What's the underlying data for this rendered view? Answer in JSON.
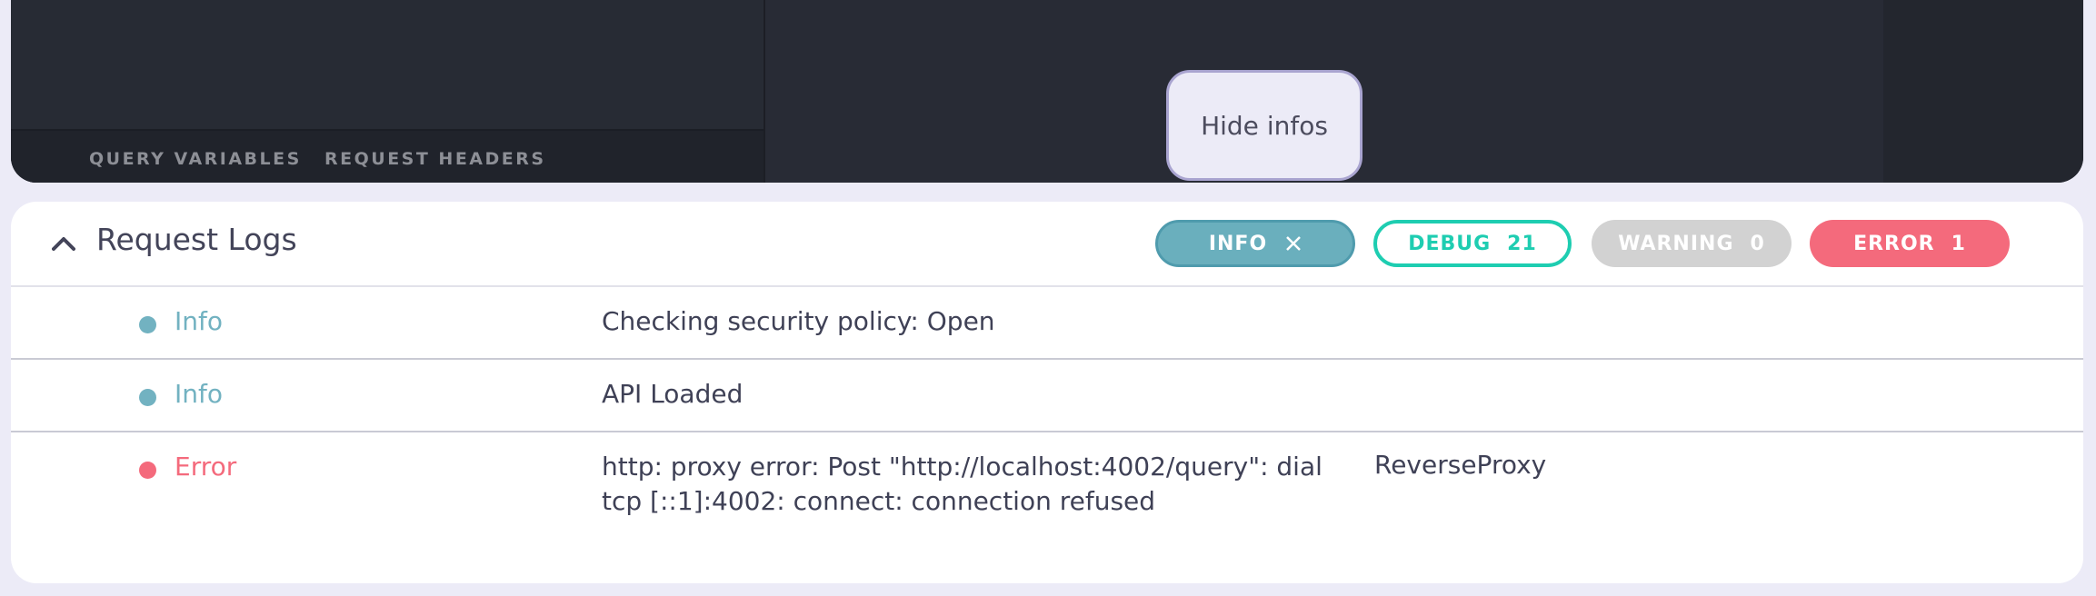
{
  "editor": {
    "tabs": [
      {
        "label": "QUERY VARIABLES"
      },
      {
        "label": "REQUEST HEADERS"
      }
    ],
    "hide_infos_label": "Hide infos"
  },
  "logs": {
    "title": "Request Logs",
    "filters": {
      "info": {
        "label": "INFO"
      },
      "debug": {
        "label": "DEBUG",
        "count": "21"
      },
      "warning": {
        "label": "WARNING",
        "count": "0"
      },
      "error": {
        "label": "ERROR",
        "count": "1"
      }
    },
    "entries": [
      {
        "level": "Info",
        "message": "Checking security policy: Open",
        "source": ""
      },
      {
        "level": "Info",
        "message": "API Loaded",
        "source": ""
      },
      {
        "level": "Error",
        "message": "http: proxy error: Post \"http://localhost:4002/query\": dial tcp [::1]:4002: connect: connection refused",
        "source": "ReverseProxy"
      }
    ]
  },
  "colors": {
    "info": "#6aafbd",
    "debug": "#1ecdb1",
    "warning": "#d2d2d2",
    "error": "#f46a7c",
    "info_level_text": "#72b2c1",
    "error_level_text": "#f46a7c"
  },
  "icons": {
    "collapse": "chevron-up-icon",
    "remove_filter": "close-icon"
  }
}
